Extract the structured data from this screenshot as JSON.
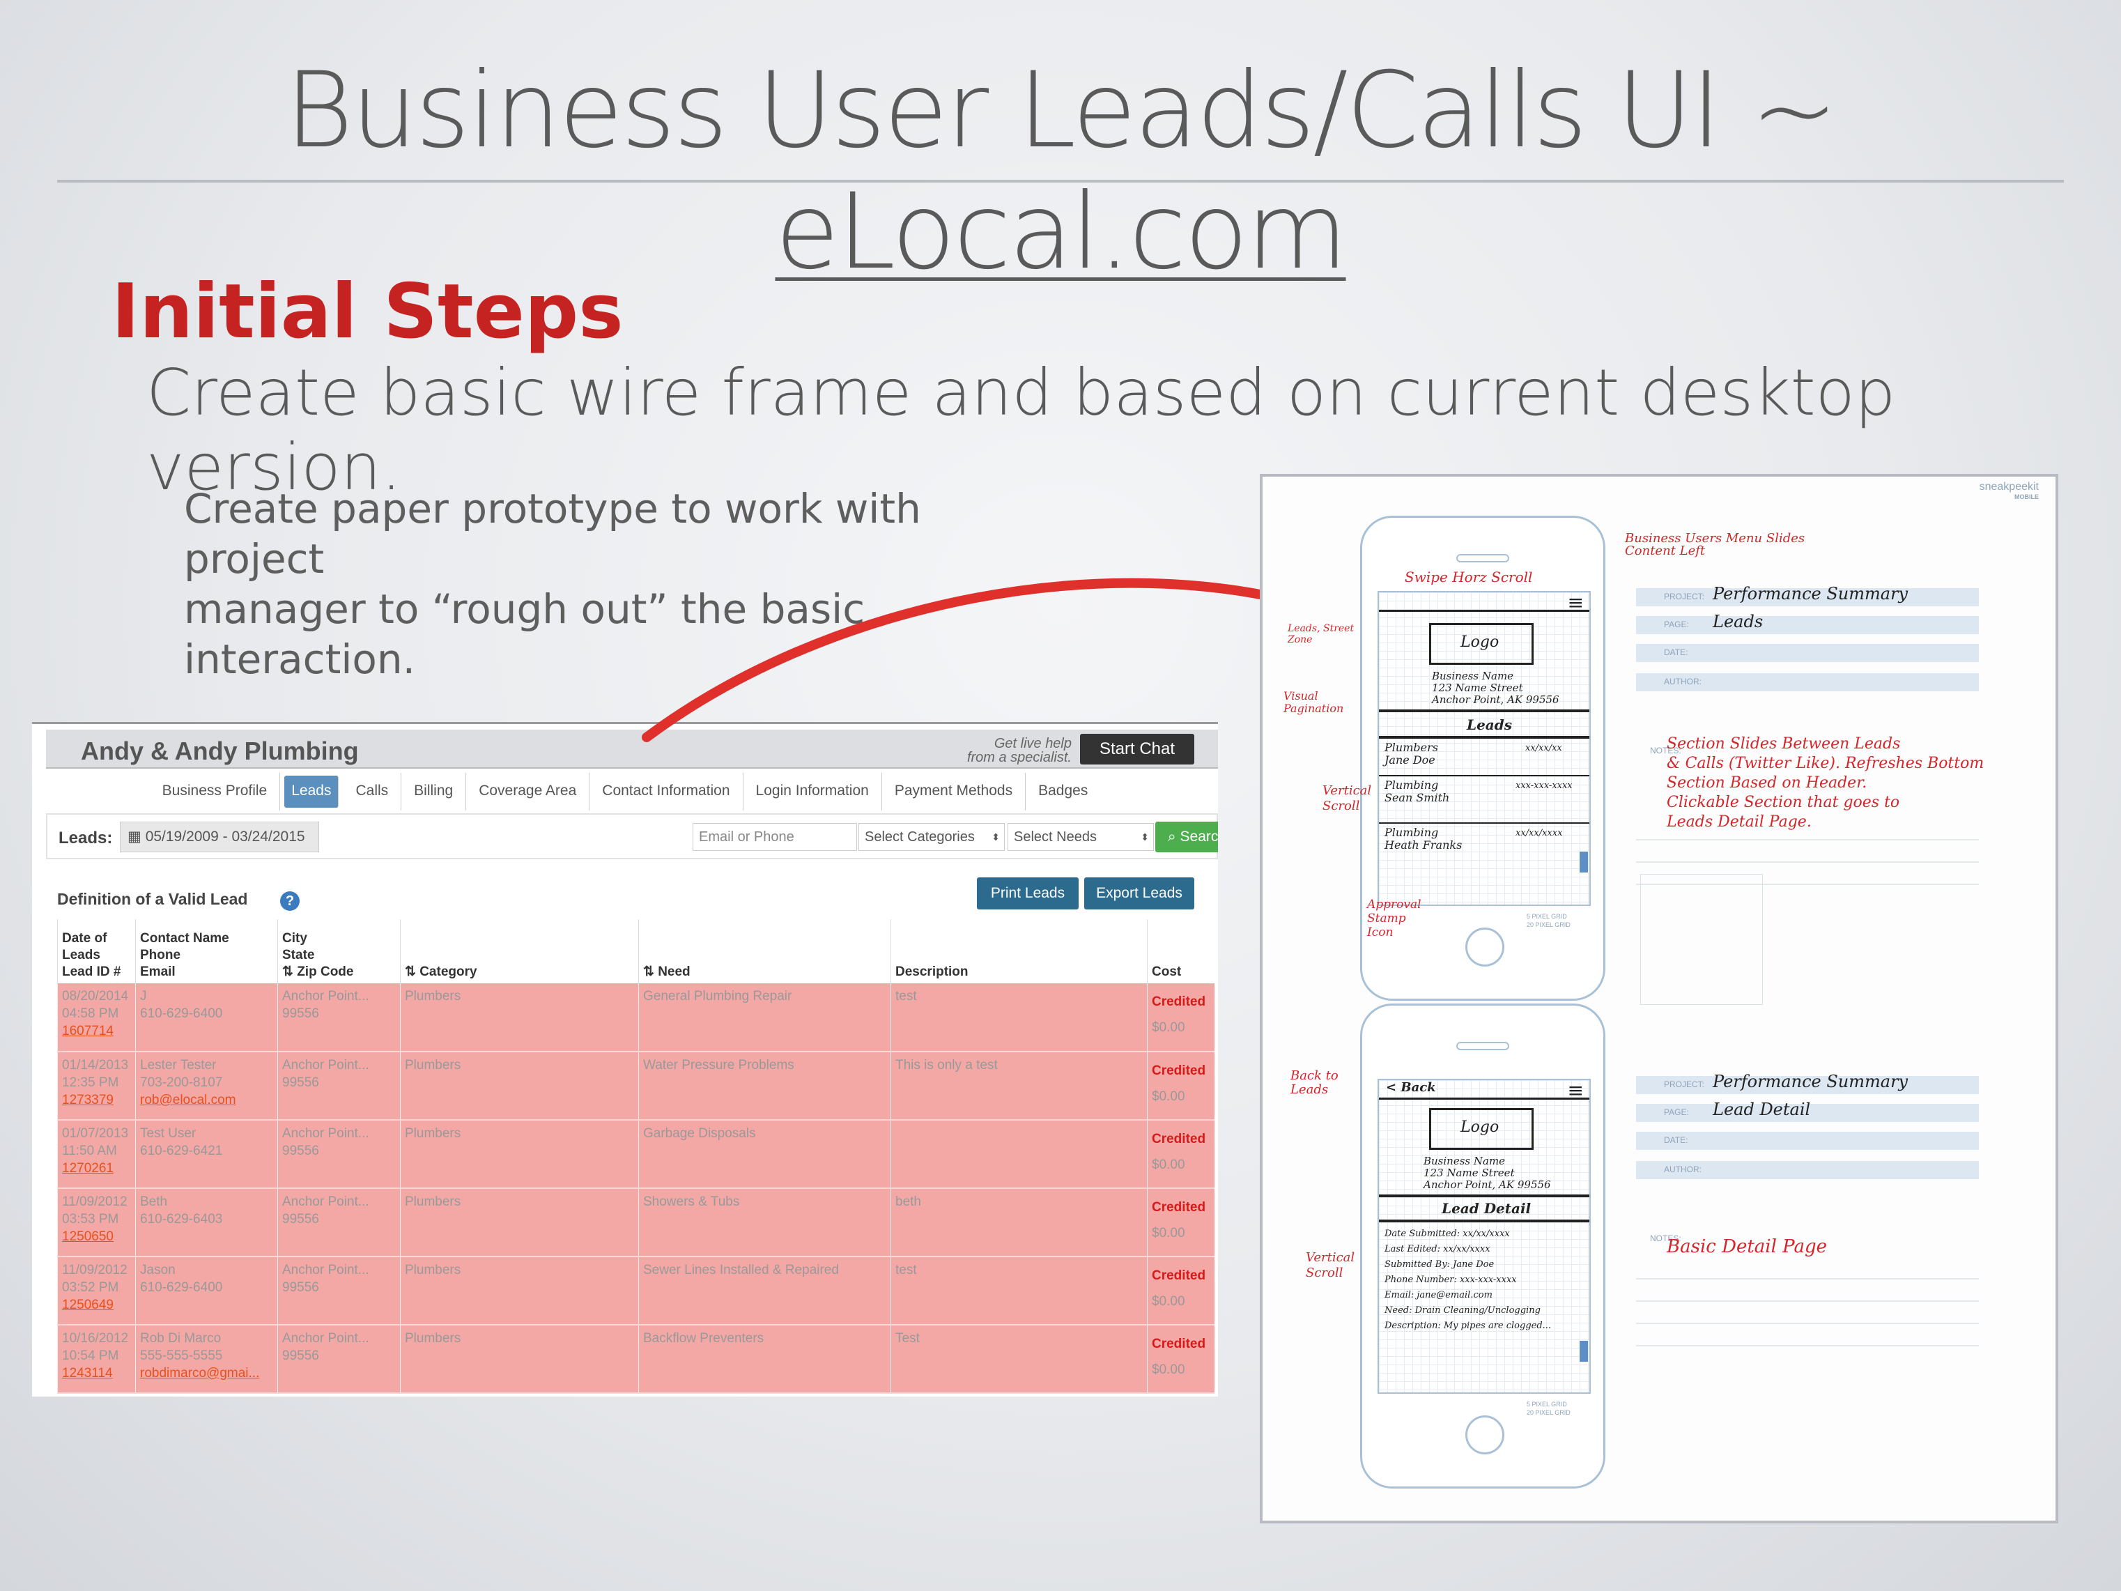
{
  "slide": {
    "title_main": "Business User Leads/Calls UI ~ ",
    "title_link": "eLocal.com",
    "subtitle": "Initial Steps",
    "main_line": "Create basic wire frame and based on current desktop version.",
    "note_line1": "Create paper prototype to work with project",
    "note_line2": "manager to “rough out” the basic interaction."
  },
  "colors": {
    "subtitle": "#c52222",
    "arrow": "#e0302c",
    "row_highlight": "#f4a8a5",
    "search": "#4cae4c",
    "action": "#2c6a8e"
  },
  "screenshot": {
    "business_name": "Andy & Andy Plumbing",
    "live_help_1": "Get live help",
    "live_help_2": "from a specialist.",
    "start_chat": "Start Chat",
    "nav": [
      "Business Profile",
      "Leads",
      "Calls",
      "Billing",
      "Coverage Area",
      "Contact Information",
      "Login Information",
      "Payment Methods",
      "Badges"
    ],
    "leads_label": "Leads:",
    "date_range": "05/19/2009 - 03/24/2015",
    "email_placeholder": "Email or Phone",
    "categories_select": "Select Categories",
    "needs_select": "Select Needs",
    "search_label": "Search",
    "definition_label": "Definition of a Valid Lead",
    "print_leads": "Print Leads",
    "export_leads": "Export Leads",
    "headers": {
      "date": [
        "Date of",
        "Leads",
        "Lead ID #"
      ],
      "contact": [
        "Contact Name",
        "Phone",
        "Email"
      ],
      "city": [
        "City",
        "State",
        "Zip Code"
      ],
      "category": "Category",
      "need": "Need",
      "description": "Description",
      "cost": "Cost"
    },
    "rows": [
      {
        "date": "08/20/2014",
        "time": "04:58 PM",
        "id": "1607714",
        "name": "J",
        "phone": "610-629-6400",
        "email": "",
        "city": "Anchor Point...",
        "zip": "99556",
        "category": "Plumbers",
        "need": "General Plumbing Repair",
        "description": "test",
        "status": "Credited",
        "cost": "$0.00"
      },
      {
        "date": "01/14/2013",
        "time": "12:35 PM",
        "id": "1273379",
        "name": "Lester Tester",
        "phone": "703-200-8107",
        "email": "rob@elocal.com",
        "city": "Anchor Point...",
        "zip": "99556",
        "category": "Plumbers",
        "need": "Water Pressure Problems",
        "description": "This is only a test",
        "status": "Credited",
        "cost": "$0.00"
      },
      {
        "date": "01/07/2013",
        "time": "11:50 AM",
        "id": "1270261",
        "name": "Test User",
        "phone": "610-629-6421",
        "email": "",
        "city": "Anchor Point...",
        "zip": "99556",
        "category": "Plumbers",
        "need": "Garbage Disposals",
        "description": "",
        "status": "Credited",
        "cost": "$0.00"
      },
      {
        "date": "11/09/2012",
        "time": "03:53 PM",
        "id": "1250650",
        "name": "Beth",
        "phone": "610-629-6403",
        "email": "",
        "city": "Anchor Point...",
        "zip": "99556",
        "category": "Plumbers",
        "need": "Showers & Tubs",
        "description": "beth",
        "status": "Credited",
        "cost": "$0.00"
      },
      {
        "date": "11/09/2012",
        "time": "03:52 PM",
        "id": "1250649",
        "name": "Jason",
        "phone": "610-629-6400",
        "email": "",
        "city": "Anchor Point...",
        "zip": "99556",
        "category": "Plumbers",
        "need": "Sewer Lines Installed & Repaired",
        "description": "test",
        "status": "Credited",
        "cost": "$0.00"
      },
      {
        "date": "10/16/2012",
        "time": "10:54 PM",
        "id": "1243114",
        "name": "Rob Di Marco",
        "phone": "555-555-5555",
        "email": "robdimarco@gmai...",
        "city": "Anchor Point...",
        "zip": "99556",
        "category": "Plumbers",
        "need": "Backflow Preventers",
        "description": "Test",
        "status": "Credited",
        "cost": "$0.00"
      }
    ]
  },
  "sketch": {
    "brand": "sneakpeekit",
    "brand_sub": "MOBILE",
    "grid_label_1": "5 PIXEL GRID",
    "grid_label_2": "20 PIXEL GRID",
    "form_labels": {
      "project": "PROJECT:",
      "page": "PAGE:",
      "date": "DATE:",
      "author": "AUTHOR:",
      "notes": "NOTES:"
    },
    "wire1": {
      "project": "Performance Summary",
      "page": "Leads",
      "ann_menu": "Business Users Menu Slides Content Left",
      "ann_swipe": "Swipe Horz Scroll",
      "ann_left": "Leads, Street Zone",
      "ann_visual": "Visual Pagination",
      "ann_vertical": "Vertical Scroll",
      "ann_approval": "Approval Stamp Icon",
      "logo": "Logo",
      "address": [
        "Business Name",
        "123 Name Street",
        "Anchor Point, AK 99556"
      ],
      "section": "Leads",
      "items": [
        [
          "Plumbers",
          "Jane Doe",
          "xx/xx/xx"
        ],
        [
          "Plumbing",
          "Sean Smith",
          "xxx-xxx-xxxx"
        ],
        [
          "Plumbing",
          "Heath Franks",
          "xx/xx/xxxx"
        ]
      ],
      "notes": [
        "Section Slides Between Leads",
        "& Calls (Twitter Like). Refreshes Bottom",
        "Section Based on Header.",
        "Clickable Section that goes to",
        "Leads Detail Page."
      ]
    },
    "wire2": {
      "project": "Performance Summary",
      "page": "Lead Detail",
      "ann_back": "Back to Leads",
      "back": "< Back",
      "ann_vertical": "Vertical Scroll",
      "logo": "Logo",
      "address": [
        "Business Name",
        "123 Name Street",
        "Anchor Point, AK 99556"
      ],
      "section": "Lead Detail",
      "fields": [
        "Date Submitted:  xx/xx/xxxx",
        "Last Edited:  xx/xx/xxxx",
        "Submitted By:  Jane Doe",
        "Phone Number:  xxx-xxx-xxxx",
        "Email:  jane@email.com",
        "Need:  Drain Cleaning/Unclogging",
        "Description:  My pipes are clogged..."
      ],
      "notes": "Basic Detail Page"
    }
  }
}
